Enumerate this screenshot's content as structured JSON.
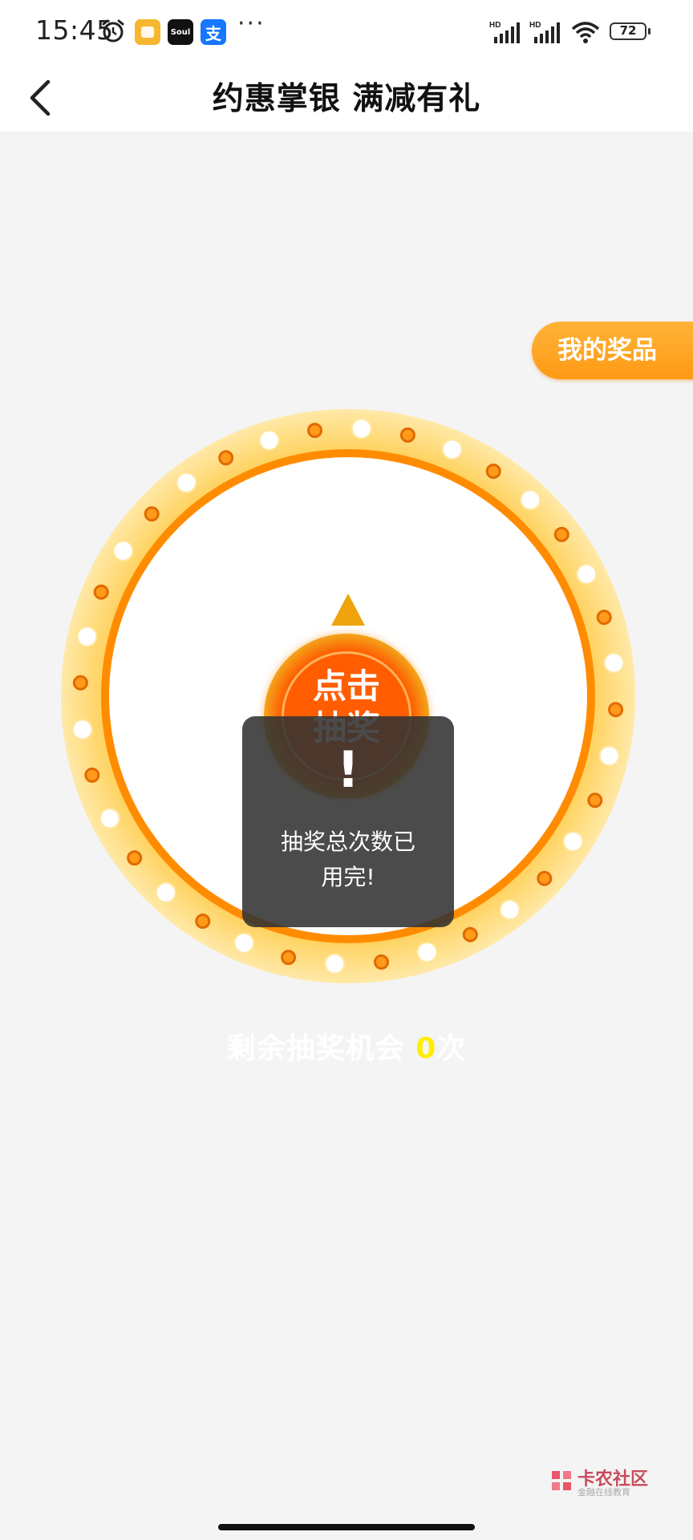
{
  "status_bar": {
    "time": "15:45",
    "icons": [
      "alarm-icon",
      "app-notification-icon",
      "soul-app-icon",
      "alipay-app-icon"
    ],
    "soul_label": "Soul",
    "alipay_label": "支",
    "more": "···",
    "signal1_label": "HD",
    "signal2_label": "HD",
    "battery": "72"
  },
  "nav": {
    "back_icon": "chevron-left-icon",
    "title": "约惠掌银 满减有礼"
  },
  "prize_tab": {
    "label": "我的奖品"
  },
  "wheel": {
    "button_line1": "点击",
    "button_line2": "抽奖",
    "colors": {
      "outer": "#ffd870",
      "ring": "#ff8c00",
      "bulb_white": "#ffffff",
      "bulb_orange": "#ff9a1a"
    }
  },
  "remaining": {
    "prefix": "剩余抽奖机会 ",
    "count": "0",
    "suffix": "次"
  },
  "toast": {
    "icon": "!",
    "message_line1": "抽奖总次数已",
    "message_line2": "用完!"
  },
  "watermark": {
    "title": "卡农社区",
    "subtitle": "金融在线教育"
  }
}
